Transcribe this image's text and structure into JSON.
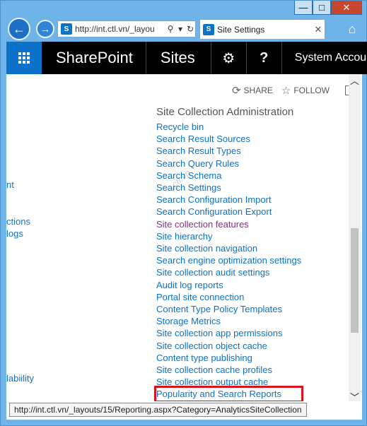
{
  "window": {
    "min": "—",
    "max": "□",
    "close": "✕"
  },
  "nav": {
    "back": "←",
    "forward": "→",
    "address": "http://int.ctl.vn/_layou",
    "tab_title": "Site Settings",
    "tab_close": "✕",
    "home": "⌂"
  },
  "suitebar": {
    "brand": "SharePoint",
    "sites": "Sites",
    "gear": "⚙",
    "help": "?",
    "account": "System Accou"
  },
  "actions": {
    "share": "SHARE",
    "follow": "FOLLOW"
  },
  "left_fragments": [
    "nt",
    "ctions",
    "logs",
    "labiility"
  ],
  "section": {
    "title": "Site Collection Administration",
    "links": [
      "Recycle bin",
      "Search Result Sources",
      "Search Result Types",
      "Search Query Rules",
      "Search Schema",
      "Search Settings",
      "Search Configuration Import",
      "Search Configuration Export",
      "Site collection features",
      "Site hierarchy",
      "Site collection navigation",
      "Search engine optimization settings",
      "Site collection audit settings",
      "Audit log reports",
      "Portal site connection",
      "Content Type Policy Templates",
      "Storage Metrics",
      "Site collection app permissions",
      "Site collection object cache",
      "Content type publishing",
      "Site collection cache profiles",
      "Site collection output cache",
      "Popularity and Search Reports"
    ]
  },
  "status": {
    "url": "http://int.ctl.vn/_layouts/15/Reporting.aspx?Category=AnalyticsSiteCollection"
  },
  "watermark": "ctl.vn"
}
